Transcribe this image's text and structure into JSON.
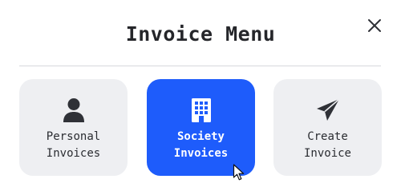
{
  "dialog": {
    "title": "Invoice Menu",
    "close_icon": "close-icon"
  },
  "options": [
    {
      "label": "Personal\nInvoices",
      "icon": "person-icon",
      "selected": false
    },
    {
      "label": "Society\nInvoices",
      "icon": "building-icon",
      "selected": true
    },
    {
      "label": "Create\nInvoice",
      "icon": "paper-plane-icon",
      "selected": false
    }
  ],
  "colors": {
    "accent": "#1e5cfb",
    "card_background": "#eeeff2",
    "icon_dark": "#2f3137",
    "text_dark": "#25262a"
  }
}
